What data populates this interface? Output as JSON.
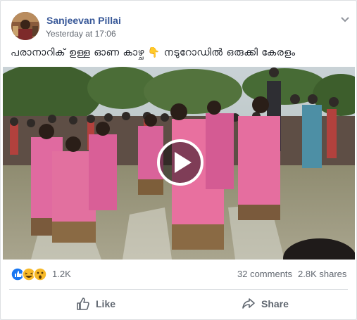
{
  "post": {
    "author": "Sanjeevan Pillai",
    "timestamp": "Yesterday at 17:06",
    "text": "പരാനാറിക് ഉള്ള ഓണ കാഴ്ച 👇 നടുറോഡിൽ ഒരുക്കി കേരളം"
  },
  "media": {
    "type": "video",
    "play_icon": "play-icon"
  },
  "stats": {
    "reaction_icons": [
      "like-icon",
      "haha-icon",
      "wow-icon"
    ],
    "reaction_count": "1.2K",
    "comments": "32 comments",
    "shares": "2.8K shares"
  },
  "actions": {
    "like_label": "Like",
    "share_label": "Share"
  },
  "colors": {
    "author": "#385898",
    "text": "#1d2129",
    "meta": "#616770",
    "like_blue": "#1877f2"
  }
}
